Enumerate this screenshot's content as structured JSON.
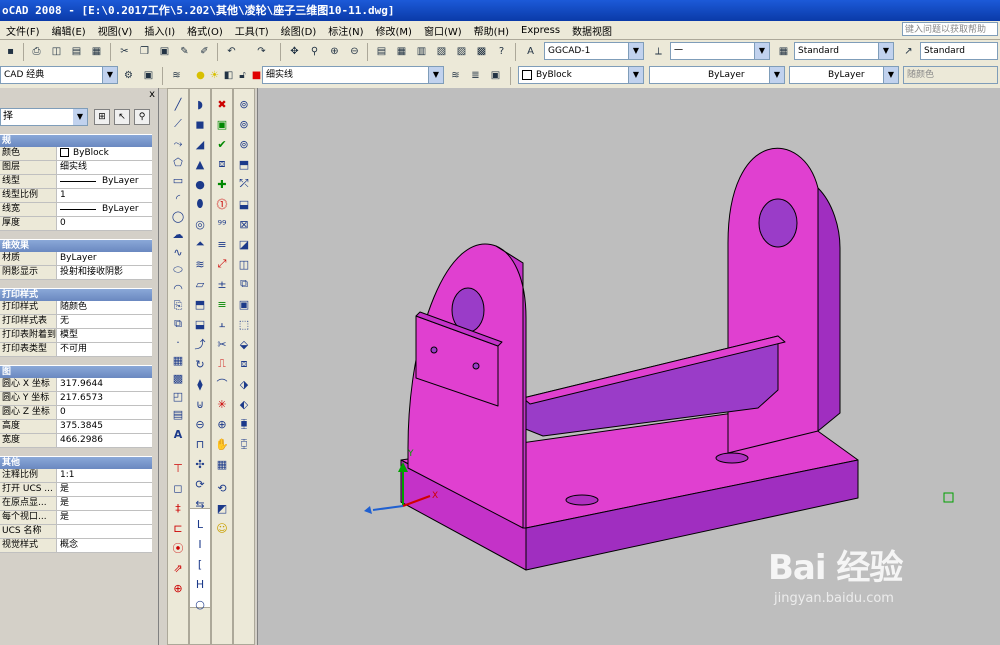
{
  "window": {
    "title": "oCAD 2008 - [E:\\0.2017工作\\5.202\\其他\\凌轮\\座子三维图10-11.dwg]"
  },
  "menu": {
    "items": [
      "文件(F)",
      "编辑(E)",
      "视图(V)",
      "插入(I)",
      "格式(O)",
      "工具(T)",
      "绘图(D)",
      "标注(N)",
      "修改(M)",
      "窗口(W)",
      "帮助(H)",
      "Express",
      "数据视图"
    ],
    "help_search_placeholder": "键入问题以获取帮助"
  },
  "toolbar1": {
    "text_style": "GGCAD-1",
    "dim_style": "一",
    "table_style": "Standard",
    "multileader_style": "Standard"
  },
  "toolbar2": {
    "workspace": "CAD 经典",
    "layer": "细实线",
    "color": "ByBlock",
    "linetype": "ByLayer",
    "lineweight": "ByLayer",
    "plotstyle": "随颜色"
  },
  "properties": {
    "close_glyph": "x",
    "selection_combo": "择",
    "sections": [
      {
        "title": "规",
        "rows": [
          {
            "key": "颜色",
            "value": "ByBlock"
          },
          {
            "key": "图层",
            "value": "细实线"
          },
          {
            "key": "线型",
            "value": "ByLayer"
          },
          {
            "key": "线型比例",
            "value": "1"
          },
          {
            "key": "线宽",
            "value": "ByLayer"
          },
          {
            "key": "厚度",
            "value": "0"
          }
        ]
      },
      {
        "title": "维效果",
        "rows": [
          {
            "key": "材质",
            "value": "ByLayer"
          },
          {
            "key": "阴影显示",
            "value": "投射和接收阴影"
          }
        ]
      },
      {
        "title": "打印样式",
        "rows": [
          {
            "key": "打印样式",
            "value": "随颜色"
          },
          {
            "key": "打印样式表",
            "value": "无"
          },
          {
            "key": "打印表附着到",
            "value": "模型"
          },
          {
            "key": "打印表类型",
            "value": "不可用"
          }
        ]
      },
      {
        "title": "图",
        "rows": [
          {
            "key": "圆心 X 坐标",
            "value": "317.9644"
          },
          {
            "key": "圆心 Y 坐标",
            "value": "217.6573"
          },
          {
            "key": "圆心 Z 坐标",
            "value": "0"
          },
          {
            "key": "高度",
            "value": "375.3845"
          },
          {
            "key": "宽度",
            "value": "466.2986"
          }
        ]
      },
      {
        "title": "其他",
        "rows": [
          {
            "key": "注释比例",
            "value": "1:1"
          },
          {
            "key": "打开 UCS ...",
            "value": "是"
          },
          {
            "key": "在原点显...",
            "value": "是"
          },
          {
            "key": "每个视口...",
            "value": "是"
          },
          {
            "key": "UCS 名称",
            "value": ""
          },
          {
            "key": "视觉样式",
            "value": "概念"
          }
        ]
      }
    ]
  },
  "viewport": {
    "ucs_labels": {
      "x": "X",
      "y": "Y"
    },
    "part_color": "#e040d0",
    "part_shadow": "#9a3cc8",
    "background": "#bebebe"
  },
  "watermark": {
    "logo": "Bai 经验",
    "url": "jingyan.baidu.com"
  }
}
